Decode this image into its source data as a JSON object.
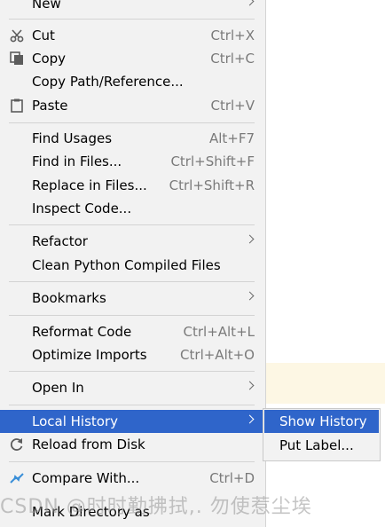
{
  "menu": {
    "new": {
      "label": "New"
    },
    "cut": {
      "label": "Cut",
      "shortcut": "Ctrl+X"
    },
    "copy": {
      "label": "Copy",
      "shortcut": "Ctrl+C"
    },
    "copy_path": {
      "label": "Copy Path/Reference..."
    },
    "paste": {
      "label": "Paste",
      "shortcut": "Ctrl+V"
    },
    "find_usages": {
      "label": "Find Usages",
      "shortcut": "Alt+F7"
    },
    "find_in_files": {
      "label": "Find in Files...",
      "shortcut": "Ctrl+Shift+F"
    },
    "replace_in_files": {
      "label": "Replace in Files...",
      "shortcut": "Ctrl+Shift+R"
    },
    "inspect_code": {
      "label": "Inspect Code..."
    },
    "refactor": {
      "label": "Refactor"
    },
    "clean_python": {
      "label": "Clean Python Compiled Files"
    },
    "bookmarks": {
      "label": "Bookmarks"
    },
    "reformat_code": {
      "label": "Reformat Code",
      "shortcut": "Ctrl+Alt+L"
    },
    "optimize_imports": {
      "label": "Optimize Imports",
      "shortcut": "Ctrl+Alt+O"
    },
    "open_in": {
      "label": "Open In"
    },
    "local_history": {
      "label": "Local History"
    },
    "reload_from_disk": {
      "label": "Reload from Disk"
    },
    "compare_with": {
      "label": "Compare With...",
      "shortcut": "Ctrl+D"
    },
    "mark_directory_as": {
      "label": "Mark Directory as"
    }
  },
  "submenu": {
    "show_history": {
      "label": "Show History"
    },
    "put_label": {
      "label": "Put Label..."
    }
  },
  "watermark": {
    "text": "CSDN @时时勤拂拭,. 勿使惹尘埃"
  },
  "icons": {
    "cut": "scissors-icon",
    "copy": "copy-icon",
    "paste": "clipboard-icon",
    "reload": "reload-icon",
    "compare": "compare-icon"
  },
  "colors": {
    "menu_bg": "#f2f2f2",
    "selection": "#2f65ca",
    "shortcut_text": "#7a7a7a",
    "separator": "#d3d3d3"
  }
}
